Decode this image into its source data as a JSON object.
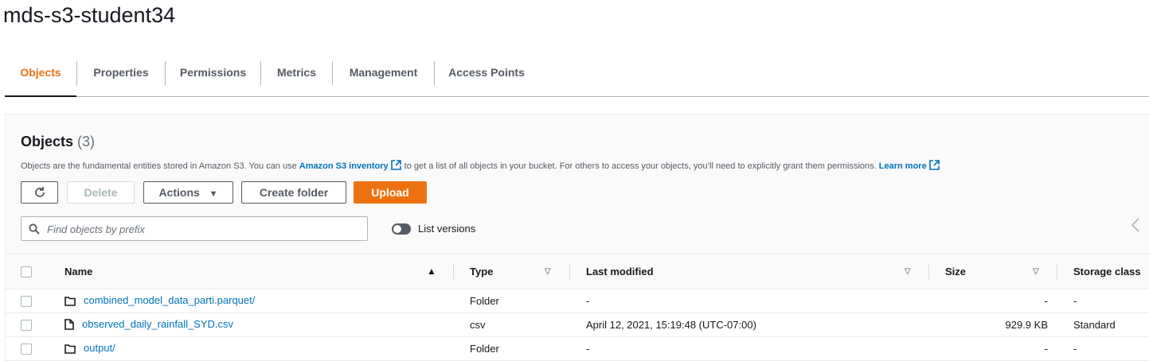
{
  "bucket_title": "mds-s3-student34",
  "tabs": [
    {
      "label": "Objects",
      "active": true
    },
    {
      "label": "Properties",
      "active": false
    },
    {
      "label": "Permissions",
      "active": false
    },
    {
      "label": "Metrics",
      "active": false
    },
    {
      "label": "Management",
      "active": false
    },
    {
      "label": "Access Points",
      "active": false
    }
  ],
  "objects_panel": {
    "heading": "Objects",
    "count": "(3)",
    "description_pre": "Objects are the fundamental entities stored in Amazon S3. You can use",
    "inventory_link": "Amazon S3 inventory",
    "description_mid": "to get a list of all objects in your bucket. For others to access your objects, you’ll need to explicitly grant them permissions.",
    "learn_more": "Learn more"
  },
  "toolbar": {
    "refresh_icon": "refresh-icon",
    "delete_label": "Delete",
    "actions_label": "Actions",
    "create_folder_label": "Create folder",
    "upload_label": "Upload"
  },
  "search": {
    "placeholder": "Find objects by prefix",
    "value": ""
  },
  "list_versions": {
    "label": "List versions",
    "enabled": false
  },
  "table": {
    "headers": {
      "name": "Name",
      "type": "Type",
      "last_modified": "Last modified",
      "size": "Size",
      "storage_class": "Storage class"
    },
    "rows": [
      {
        "icon": "folder-icon",
        "name": "combined_model_data_parti.parquet/",
        "type": "Folder",
        "last_modified": "-",
        "size": "-",
        "storage_class": "-"
      },
      {
        "icon": "file-icon",
        "name": "observed_daily_rainfall_SYD.csv",
        "type": "csv",
        "last_modified": "April 12, 2021, 15:19:48 (UTC-07:00)",
        "size": "929.9 KB",
        "storage_class": "Standard"
      },
      {
        "icon": "folder-icon",
        "name": "output/",
        "type": "Folder",
        "last_modified": "-",
        "size": "-",
        "storage_class": "-"
      }
    ]
  },
  "colors": {
    "accent": "#ec7211",
    "link": "#0073bb",
    "text": "#16191f",
    "secondary": "#545b64"
  }
}
